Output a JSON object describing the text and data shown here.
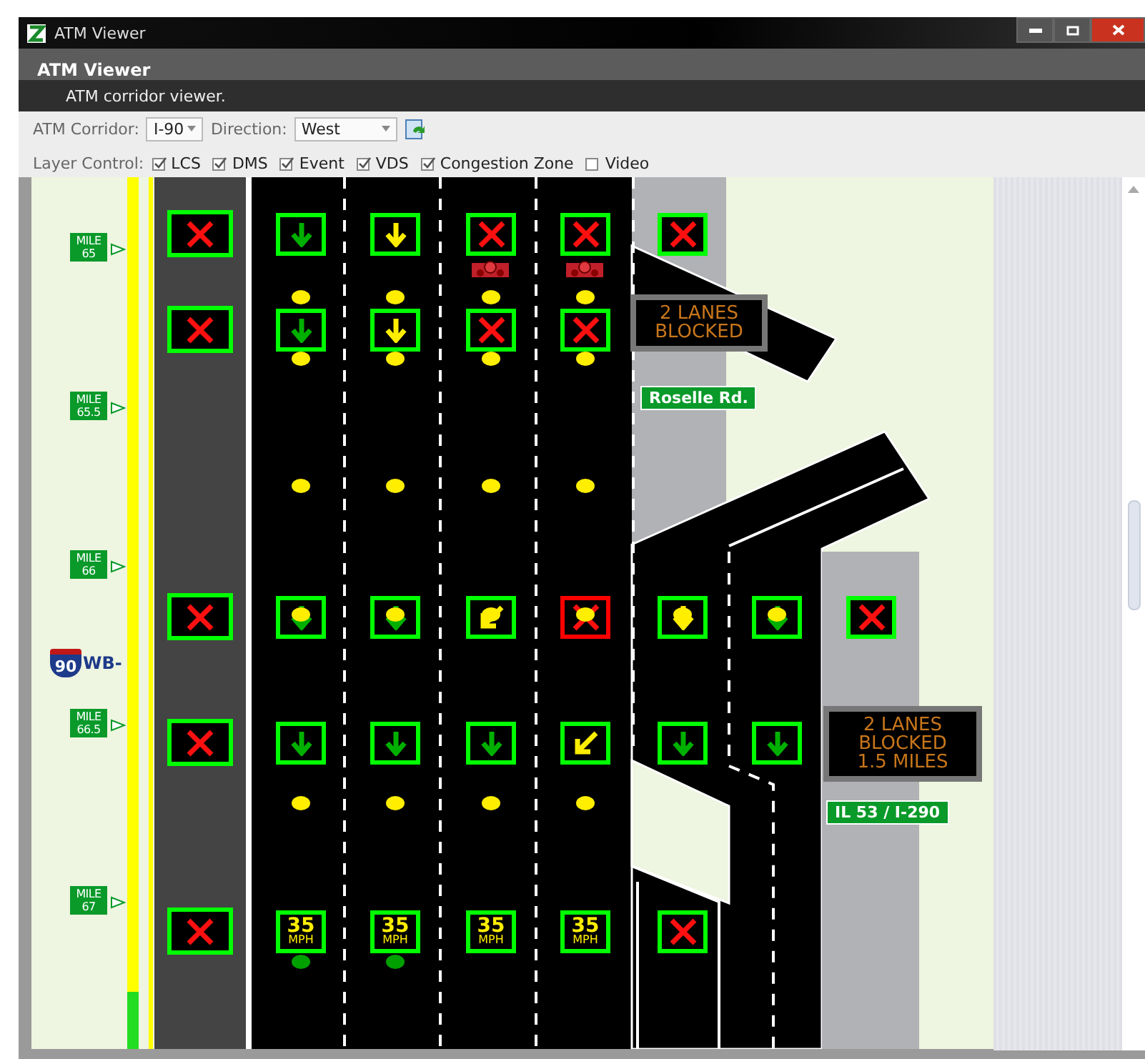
{
  "window": {
    "title": "ATM Viewer"
  },
  "header": {
    "title": "ATM Viewer",
    "subtitle": "ATM corridor viewer."
  },
  "toolbar": {
    "corridor_label": "ATM Corridor:",
    "corridor": "I-90",
    "direction_label": "Direction:",
    "direction": "West",
    "layer_label": "Layer Control:",
    "layers": [
      {
        "label": "LCS",
        "checked": true
      },
      {
        "label": "DMS",
        "checked": true
      },
      {
        "label": "Event",
        "checked": true
      },
      {
        "label": "VDS",
        "checked": true
      },
      {
        "label": "Congestion Zone",
        "checked": true
      },
      {
        "label": "Video",
        "checked": false
      }
    ]
  },
  "map": {
    "mile_markers": [
      {
        "label": "MILE",
        "value": "65"
      },
      {
        "label": "MILE",
        "value": "65.5"
      },
      {
        "label": "MILE",
        "value": "66"
      },
      {
        "label": "MILE",
        "value": "66.5"
      },
      {
        "label": "MILE",
        "value": "67"
      }
    ],
    "route_shield": {
      "number": "90",
      "suffix": "WB-"
    },
    "sign_rows": [
      {
        "cells": [
          {
            "kind": "closed",
            "color": "#00ff00"
          },
          {
            "kind": "down",
            "symbol": {
              "color": "#00b000"
            },
            "color": "#00ff00"
          },
          {
            "kind": "down",
            "symbol": {
              "color": "#ffee00"
            },
            "color": "#00ff00"
          },
          {
            "kind": "closed",
            "color": "#00ff00",
            "camera": true
          },
          {
            "kind": "closed",
            "color": "#00ff00",
            "camera": true
          },
          {
            "kind": "closed",
            "color": "#00ff00"
          }
        ]
      },
      {
        "cells": [
          {
            "kind": "closed",
            "color": "#00ff00"
          },
          {
            "kind": "down",
            "symbol": {
              "color": "#00b000"
            },
            "color": "#00ff00"
          },
          {
            "kind": "down",
            "symbol": {
              "color": "#ffee00"
            },
            "color": "#00ff00"
          },
          {
            "kind": "closed",
            "color": "#00ff00"
          },
          {
            "kind": "closed",
            "color": "#00ff00"
          }
        ]
      },
      {
        "cells": [
          {
            "kind": "closed",
            "color": "#00ff00"
          },
          {
            "kind": "down",
            "symbol": {
              "color": "#00b000"
            },
            "color": "#00ff00"
          },
          {
            "kind": "down",
            "symbol": {
              "color": "#00b000"
            },
            "color": "#00ff00"
          },
          {
            "kind": "merge_left",
            "symbol": {
              "color": "#ffee00"
            },
            "color": "#00ff00"
          },
          {
            "kind": "closed",
            "color": "#ff0000"
          },
          {
            "kind": "down",
            "symbol": {
              "color": "#ffee00"
            },
            "color": "#00ff00"
          },
          {
            "kind": "down",
            "symbol": {
              "color": "#00b000"
            },
            "color": "#00ff00"
          },
          {
            "kind": "closed",
            "color": "#00ff00"
          }
        ]
      },
      {
        "cells": [
          {
            "kind": "closed",
            "color": "#00ff00"
          },
          {
            "kind": "down",
            "symbol": {
              "color": "#00b000"
            },
            "color": "#00ff00"
          },
          {
            "kind": "down",
            "symbol": {
              "color": "#00b000"
            },
            "color": "#00ff00"
          },
          {
            "kind": "down",
            "symbol": {
              "color": "#00b000"
            },
            "color": "#00ff00"
          },
          {
            "kind": "merge_left",
            "symbol": {
              "color": "#ffee00"
            },
            "color": "#00ff00"
          },
          {
            "kind": "down",
            "symbol": {
              "color": "#00b000"
            },
            "color": "#00ff00"
          },
          {
            "kind": "down",
            "symbol": {
              "color": "#00b000"
            },
            "color": "#00ff00"
          }
        ]
      },
      {
        "cells": [
          {
            "kind": "closed",
            "color": "#00ff00"
          },
          {
            "kind": "speed",
            "speed": "35",
            "unit": "MPH",
            "color": "#00ff00"
          },
          {
            "kind": "speed",
            "speed": "35",
            "unit": "MPH",
            "color": "#00ff00"
          },
          {
            "kind": "speed",
            "speed": "35",
            "unit": "MPH",
            "color": "#00ff00"
          },
          {
            "kind": "speed",
            "speed": "35",
            "unit": "MPH",
            "color": "#00ff00"
          },
          {
            "kind": "closed",
            "color": "#00ff00"
          }
        ]
      }
    ],
    "detector_rows": [
      {
        "dots": [
          {
            "color": "#ffee00"
          },
          {
            "color": "#ffee00"
          },
          {
            "color": "#ffee00"
          },
          {
            "color": "#ffee00"
          }
        ]
      },
      {
        "dots": [
          {
            "color": "#ffee00"
          },
          {
            "color": "#ffee00"
          },
          {
            "color": "#ffee00"
          },
          {
            "color": "#ffee00"
          }
        ]
      },
      {
        "dots": [
          {
            "color": "#ffee00"
          },
          {
            "color": "#ffee00"
          },
          {
            "color": "#ffee00"
          },
          {
            "color": "#ffee00"
          }
        ]
      },
      {
        "dots": [
          {
            "color": "#ffee00"
          },
          {
            "color": "#ffee00"
          },
          {
            "color": "#ffee00"
          },
          {
            "color": "#ffee00"
          },
          {
            "color": "#ffee00"
          },
          {
            "color": "#ffee00"
          }
        ]
      },
      {
        "dots": [
          {
            "color": "#ffee00"
          },
          {
            "color": "#ffee00"
          },
          {
            "color": "#ffee00"
          },
          {
            "color": "#ffee00"
          }
        ]
      },
      {
        "dots": [
          {
            "color": "#00a000"
          },
          {
            "color": "#00a000"
          }
        ]
      }
    ],
    "dms": [
      {
        "lines": [
          "2 LANES",
          "BLOCKED"
        ]
      },
      {
        "lines": [
          "2 LANES",
          "BLOCKED",
          "1.5 MILES"
        ]
      }
    ],
    "road_labels": [
      "Roselle Rd.",
      "IL 53 / I-290"
    ]
  }
}
